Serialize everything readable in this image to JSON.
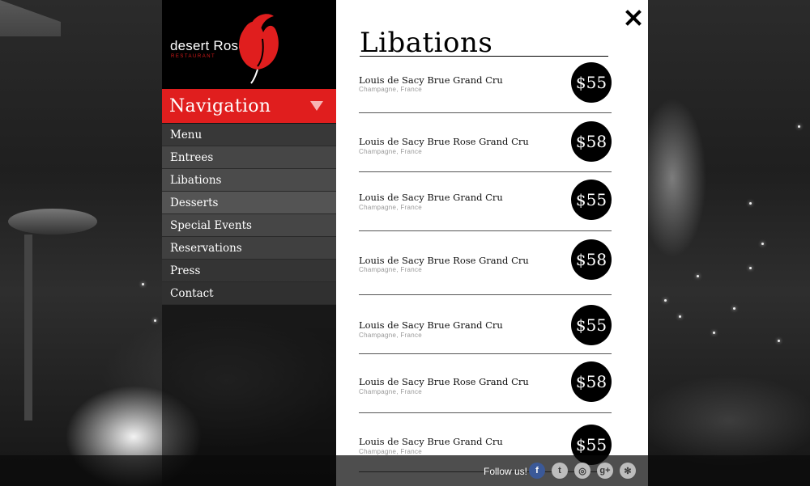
{
  "brand": {
    "name": "desert Rose",
    "subtitle": "RESTAURANT",
    "accent": "#e01e1e"
  },
  "navigation": {
    "title": "Navigation",
    "items": [
      {
        "label": "Menu"
      },
      {
        "label": "Entrees"
      },
      {
        "label": "Libations"
      },
      {
        "label": "Desserts"
      },
      {
        "label": "Special Events"
      },
      {
        "label": "Reservations"
      },
      {
        "label": "Press"
      },
      {
        "label": "Contact"
      }
    ]
  },
  "panel": {
    "title": "Libations",
    "items": [
      {
        "name": "Louis de Sacy Brue Grand Cru",
        "location": "Champagne, France",
        "price": "$55"
      },
      {
        "name": "Louis de Sacy Brue Rose Grand Cru",
        "location": "Champagne, France",
        "price": "$58"
      },
      {
        "name": "Louis de Sacy Brue Grand Cru",
        "location": "Champagne, France",
        "price": "$55"
      },
      {
        "name": "Louis de Sacy Brue Rose Grand Cru",
        "location": "Champagne, France",
        "price": "$58"
      },
      {
        "name": "Louis de Sacy Brue Grand Cru",
        "location": "Champagne, France",
        "price": "$55"
      },
      {
        "name": "Louis de Sacy Brue Rose Grand Cru",
        "location": "Champagne, France",
        "price": "$58"
      },
      {
        "name": "Louis de Sacy Brue Grand Cru",
        "location": "Champagne, France",
        "price": "$55"
      }
    ]
  },
  "footer": {
    "follow_label": "Follow us!",
    "social": [
      {
        "icon": "facebook-icon",
        "glyph": "f"
      },
      {
        "icon": "twitter-icon",
        "glyph": "t"
      },
      {
        "icon": "instagram-icon",
        "glyph": "◎"
      },
      {
        "icon": "google-plus-icon",
        "glyph": "g+"
      },
      {
        "icon": "yelp-icon",
        "glyph": "✻"
      }
    ]
  }
}
